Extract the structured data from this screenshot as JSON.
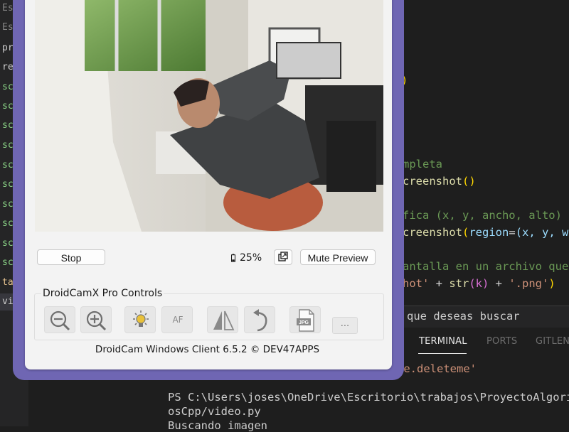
{
  "vscode": {
    "sidebar_items": [
      {
        "text": "Es",
        "selected": false
      },
      {
        "text": "Es",
        "selected": false
      },
      {
        "text": "pr",
        "selected": false
      },
      {
        "text": "re",
        "selected": false
      },
      {
        "text": "sc",
        "selected": false
      },
      {
        "text": "sc",
        "selected": false
      },
      {
        "text": "sc",
        "selected": false
      },
      {
        "text": "sc",
        "selected": false
      },
      {
        "text": "sc",
        "selected": false
      },
      {
        "text": "sc",
        "selected": false
      },
      {
        "text": "sc",
        "selected": false
      },
      {
        "text": "sc",
        "selected": false
      },
      {
        "text": "sc",
        "selected": false
      },
      {
        "text": "sc",
        "selected": false
      },
      {
        "text": "tar",
        "selected": false
      },
      {
        "text": "vic",
        "selected": true
      }
    ],
    "editor_lines": {
      "paren": ")",
      "comment1": "mpleta",
      "call1": "creenshot",
      "call1_parens": "()",
      "comment2": "fica (x, y, ancho, alto)",
      "call2": "creenshot",
      "call2_open": "(",
      "call2_kw": "region",
      "call2_eq": "=",
      "call2_args": "(x, y, w",
      "comment3": "antalla en un archivo que",
      "save_str1": "hot'",
      "save_plus1": " + ",
      "save_func": "str",
      "save_arg": "(k)",
      "save_plus2": " + ",
      "save_str2": "'.png'",
      "save_close": ")"
    },
    "input_placeholder": "vo que deseas buscar",
    "panel_tabs": {
      "terminal": "TERMINAL",
      "ports": "PORTS",
      "gitlens": "GITLENS"
    },
    "terminal_lines": {
      "line0": "xe.deleteme'",
      "line1": "PS C:\\Users\\joses\\OneDrive\\Escritorio\\trabajos\\ProyectoAlgoritm",
      "line2": "osCpp/video.py",
      "line3": "Buscando imagen"
    },
    "colors": {
      "comment": "#6a9955",
      "function": "#dcdcaa",
      "string": "#ce9178",
      "variable": "#9cdcfe",
      "keyword_param": "#9cdcfe",
      "bracket1": "#ffd700",
      "bracket2": "#da70d6",
      "sidebar_green": "#89d185",
      "sidebar_gray": "#858585"
    }
  },
  "droidcam": {
    "stop_label": "Stop",
    "battery_text": "25%",
    "battery_level": 0.25,
    "mute_label": "Mute Preview",
    "pro_controls_label": "DroidCamX Pro Controls",
    "tools": [
      {
        "name": "zoom-out-icon"
      },
      {
        "name": "zoom-in-icon"
      },
      {
        "name": "light-icon"
      },
      {
        "name": "autofocus",
        "label": "AF"
      },
      {
        "name": "flip-icon"
      },
      {
        "name": "rotate-icon"
      },
      {
        "name": "jpg-icon",
        "label": "JPG"
      },
      {
        "name": "more",
        "label": "..."
      }
    ],
    "footer": "DroidCam Windows Client 6.5.2 © DEV47APPS",
    "frame_color": "#6f66b3"
  }
}
